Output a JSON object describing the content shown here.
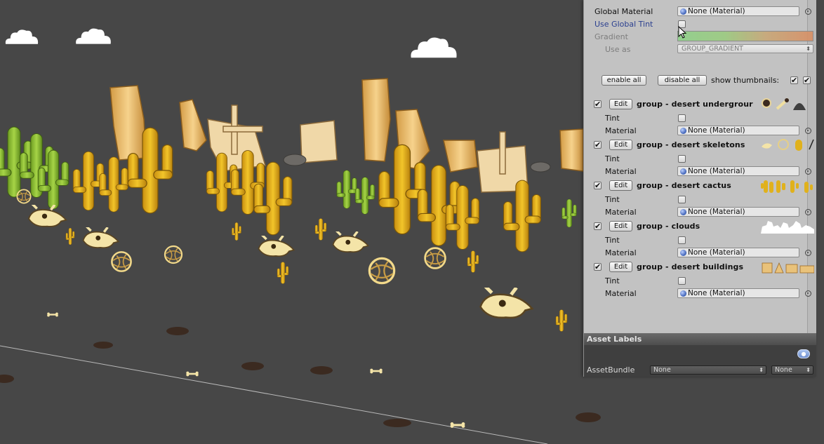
{
  "inspector": {
    "global_material": {
      "label": "Global Material",
      "value": "None (Material)"
    },
    "use_global_tint": {
      "label": "Use Global Tint",
      "checked": false
    },
    "gradient": {
      "label": "Gradient"
    },
    "use_as": {
      "label": "Use as",
      "value": "GROUP_GRADIENT"
    },
    "enable_all": "enable all",
    "disable_all": "disable all",
    "show_thumbnails": {
      "label": "show thumbnails:",
      "checked_a": true,
      "checked_b": true
    },
    "groups": [
      {
        "enabled": true,
        "edit": "Edit",
        "title": "group - desert undergrour",
        "tint_label": "Tint",
        "material_label": "Material",
        "material_value": "None (Material)"
      },
      {
        "enabled": true,
        "edit": "Edit",
        "title": "group - desert skeletons",
        "tint_label": "Tint",
        "material_label": "Material",
        "material_value": "None (Material)"
      },
      {
        "enabled": true,
        "edit": "Edit",
        "title": "group - desert cactus",
        "tint_label": "Tint",
        "material_label": "Material",
        "material_value": "None (Material)"
      },
      {
        "enabled": true,
        "edit": "Edit",
        "title": "group - clouds",
        "tint_label": "Tint",
        "material_label": "Material",
        "material_value": "None (Material)"
      },
      {
        "enabled": true,
        "edit": "Edit",
        "title": "group - desert buildings",
        "tint_label": "Tint",
        "material_label": "Material",
        "material_value": "None (Material)"
      }
    ]
  },
  "asset_labels": {
    "header": "Asset Labels",
    "assetbundle_label": "AssetBundle",
    "assetbundle_value": "None",
    "variant_value": "None"
  },
  "colors": {
    "scene_background": "#474747",
    "cactus_yellow": "#e0b11c",
    "cactus_green": "#8fc23a",
    "rock_sand": "#e9c27a",
    "inspector_bg": "#c2c2c2"
  }
}
